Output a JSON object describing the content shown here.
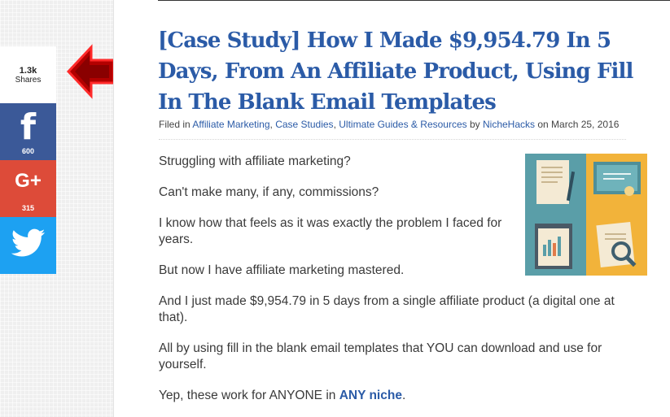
{
  "share": {
    "total_count": "1.3k",
    "total_label": "Shares",
    "facebook": {
      "icon": "facebook-icon",
      "glyph": "f",
      "count": "600",
      "color": "#3b5998"
    },
    "googleplus": {
      "icon": "google-plus-icon",
      "glyph": "G+",
      "count": "315",
      "color": "#dd4b39"
    },
    "twitter": {
      "icon": "twitter-bird-icon",
      "color": "#1da1f2"
    }
  },
  "annotation": {
    "icon": "red-arrow-icon",
    "color": "#c00000"
  },
  "article": {
    "title": "[Case Study] How I Made $9,954.79 In 5 Days, From An Affiliate Product, Using Fill In The Blank Email Templates",
    "meta": {
      "filed_in": "Filed in",
      "categories": [
        "Affiliate Marketing",
        "Case Studies",
        "Ultimate Guides & Resources"
      ],
      "sep1": ", ",
      "sep2": ", ",
      "by": " by ",
      "author": "NicheHacks",
      "on": " on ",
      "date": "March 25, 2016"
    },
    "paragraphs": [
      "Struggling with affiliate marketing?",
      "Can't make many, if any, commissions?",
      "I know how that feels as it was exactly the problem I faced for years.",
      "But now I have affiliate marketing mastered.",
      "And I just made $9,954.79 in 5 days from a single affiliate product (a digital one at that).",
      "All by using fill in the blank email templates that YOU can download and use for yourself."
    ],
    "last_paragraph": {
      "before": "Yep, these work for ANYONE in ",
      "link": "ANY niche",
      "after": "."
    },
    "illustration": "documents-illustration-icon"
  },
  "colors": {
    "link": "#2b5ba7",
    "title": "#2b5ba7"
  }
}
